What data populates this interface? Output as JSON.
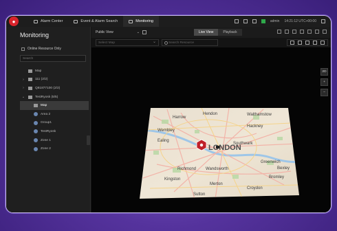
{
  "window": {
    "tabs": [
      {
        "label": "Alarm Center",
        "icon": "bell-icon"
      },
      {
        "label": "Event & Alarm Search",
        "icon": "search-icon"
      },
      {
        "label": "Monitoring",
        "icon": "camera-icon",
        "active": true
      }
    ],
    "user": "admin",
    "clock": "14:21:12 UTC+00:00"
  },
  "sidebar": {
    "title": "Monitoring",
    "online_only_label": "Online Resource Only",
    "search_placeholder": "Search",
    "tree": [
      {
        "label": "Map",
        "level": 0,
        "type": "map"
      },
      {
        "label": "111 (2/2)",
        "level": 0,
        "type": "site",
        "arrow": "›"
      },
      {
        "label": "Q81877100 (2/2)",
        "level": 0,
        "type": "site",
        "arrow": "›"
      },
      {
        "label": "TestRyosk (5/5)",
        "level": 0,
        "type": "site",
        "arrow": "⌄"
      },
      {
        "label": "Map",
        "level": 1,
        "type": "map",
        "selected": true
      },
      {
        "label": "Area 2",
        "level": 1,
        "type": "area"
      },
      {
        "label": "Group1",
        "level": 1,
        "type": "area"
      },
      {
        "label": "TestRyosk",
        "level": 1,
        "type": "area"
      },
      {
        "label": "Zone 1",
        "level": 1,
        "type": "area"
      },
      {
        "label": "Zone 2",
        "level": 1,
        "type": "area"
      }
    ]
  },
  "toolbar": {
    "view_label": "Public View",
    "live_view_label": "Live View",
    "playback_label": "Playback"
  },
  "filter": {
    "select_map_placeholder": "Select Map",
    "search_resource_placeholder": "Search Resource"
  },
  "map": {
    "mode_label": "2D",
    "zoom_in": "+",
    "zoom_out": "−",
    "place_labels": [
      "Harrow",
      "Hendon",
      "Walthamstow",
      "Wembley",
      "Hackney",
      "Ealing",
      "LONDON",
      "Southwark",
      "Richmond",
      "Wandsworth",
      "Greenwich",
      "Kingston",
      "Merton",
      "Croydon",
      "Bromley",
      "Sutton",
      "Bexley"
    ],
    "pin_color": "#c0202a"
  }
}
